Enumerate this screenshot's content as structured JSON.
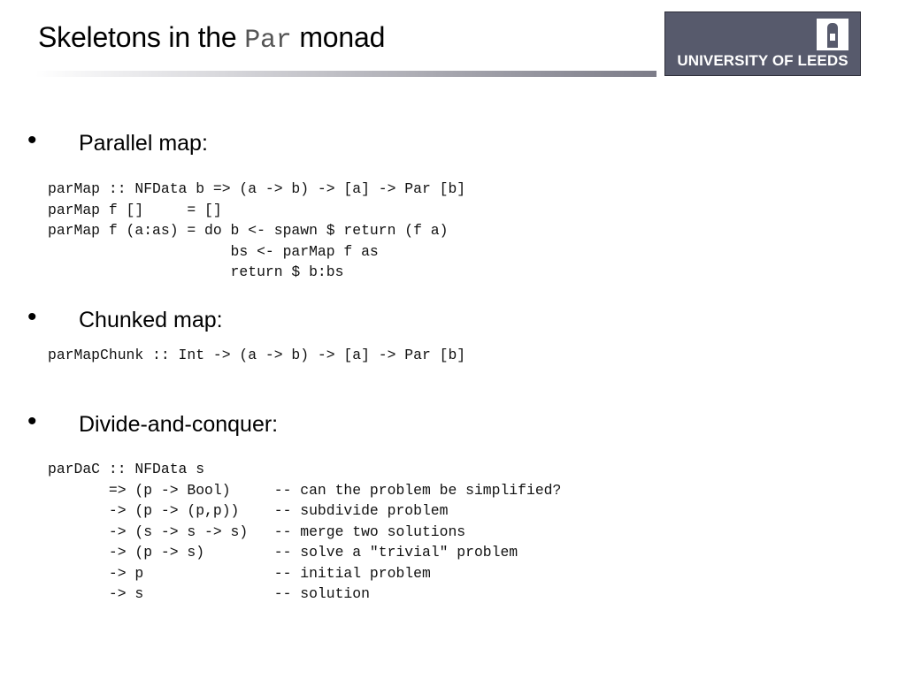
{
  "header": {
    "title_before": "Skeletons in the ",
    "title_code": "Par",
    "title_after": " monad",
    "logo_text": "UNIVERSITY OF LEEDS",
    "logo_color": "#575a6c"
  },
  "sections": [
    {
      "bullet": "Parallel map:",
      "code": "parMap :: NFData b => (a -> b) -> [a] -> Par [b]\nparMap f []     = []\nparMap f (a:as) = do b <- spawn $ return (f a)\n                     bs <- parMap f as\n                     return $ b:bs"
    },
    {
      "bullet": "Chunked map:",
      "code": "parMapChunk :: Int -> (a -> b) -> [a] -> Par [b]"
    },
    {
      "bullet": "Divide-and-conquer:",
      "code": "parDaC :: NFData s\n       => (p -> Bool)     -- can the problem be simplified?\n       -> (p -> (p,p))    -- subdivide problem\n       -> (s -> s -> s)   -- merge two solutions\n       -> (p -> s)        -- solve a \"trivial\" problem\n       -> p               -- initial problem\n       -> s               -- solution"
    }
  ]
}
